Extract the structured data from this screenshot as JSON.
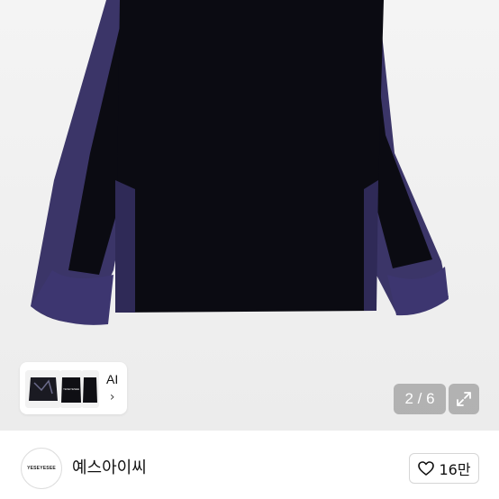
{
  "gallery": {
    "counter": "2 / 6",
    "ai_label": "AI",
    "chevron": "›",
    "thumb_logo": "YESEYESEE"
  },
  "seller": {
    "avatar_text": "YESEYESEE",
    "name": "예스아이씨"
  },
  "like": {
    "count": "16만"
  },
  "colors": {
    "body": "#0b0b12",
    "panel": "#3b3568",
    "background": "#efefef"
  },
  "icons": [
    "expand-icon",
    "heart-icon",
    "chevron-right-icon"
  ]
}
